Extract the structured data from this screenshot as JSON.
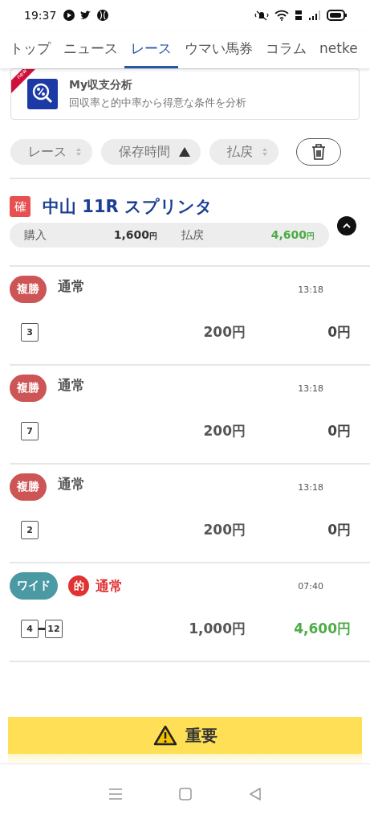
{
  "status_bar": {
    "time": "19:37"
  },
  "tabs": [
    {
      "label": "トップ",
      "selected": false
    },
    {
      "label": "ニュース",
      "selected": false
    },
    {
      "label": "レース",
      "selected": true
    },
    {
      "label": "ウマい馬券",
      "selected": false
    },
    {
      "label": "コラム",
      "selected": false
    },
    {
      "label": "netke",
      "selected": false
    }
  ],
  "promo": {
    "badge": "new",
    "title": "My収支分析",
    "subtitle": "回収率と的中率から得意な条件を分析"
  },
  "sort_chips": [
    {
      "label": "レース",
      "active": false
    },
    {
      "label": "保存時間",
      "active": true
    },
    {
      "label": "払戻",
      "active": false
    }
  ],
  "race": {
    "badge": "確",
    "title": "中山 11R スプリンタ",
    "expanded": true,
    "summary": {
      "purchase_label": "購入",
      "purchase": "1,600",
      "purchase_unit": "円",
      "payout_label": "払戻",
      "payout": "4,600",
      "payout_unit": "円"
    }
  },
  "bets": [
    {
      "type": "複勝",
      "color": "#cd5555",
      "hit": false,
      "name": "通常",
      "time": "13:18",
      "numbers": [
        "3"
      ],
      "amount": "200円",
      "payout": "0円"
    },
    {
      "type": "複勝",
      "color": "#cd5555",
      "hit": false,
      "name": "通常",
      "time": "13:18",
      "numbers": [
        "7"
      ],
      "amount": "200円",
      "payout": "0円"
    },
    {
      "type": "複勝",
      "color": "#cd5555",
      "hit": false,
      "name": "通常",
      "time": "13:18",
      "numbers": [
        "2"
      ],
      "amount": "200円",
      "payout": "0円"
    },
    {
      "type": "ワイド",
      "color": "#4b9aa3",
      "hit": true,
      "hit_label": "的",
      "name": "通常",
      "time": "07:40",
      "numbers": [
        "4",
        "12"
      ],
      "amount": "1,000円",
      "payout": "4,600円"
    }
  ],
  "notice": {
    "label": "重要"
  }
}
